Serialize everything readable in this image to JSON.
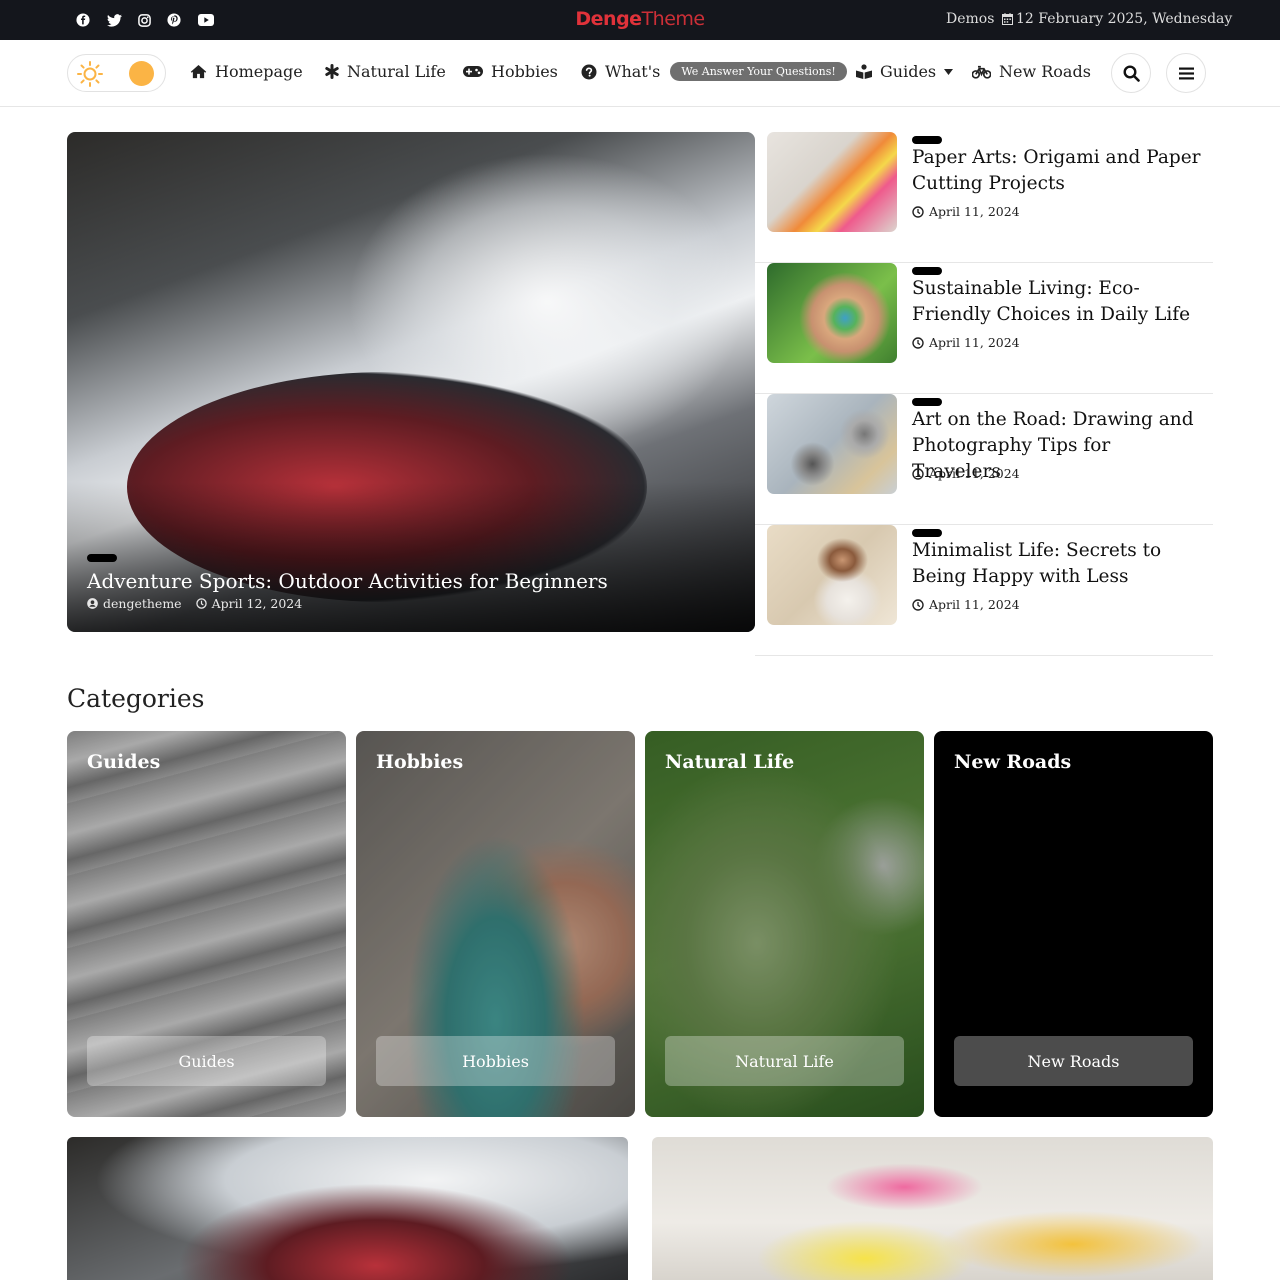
{
  "topbar": {
    "social_icons": [
      "facebook-icon",
      "twitter-icon",
      "instagram-icon",
      "pinterest-icon",
      "youtube-icon"
    ],
    "logo_part1": "Denge",
    "logo_part2": "Theme",
    "demos_label": "Demos",
    "date_text": "12 February 2025, Wednesday"
  },
  "nav": {
    "items": [
      {
        "label": "Homepage",
        "icon": "home-icon"
      },
      {
        "label": "Natural Life",
        "icon": "asterisk-icon"
      },
      {
        "label": "Hobbies",
        "icon": "gamepad-icon"
      },
      {
        "label": "What's",
        "icon": "question-icon"
      },
      {
        "label": "Guides",
        "icon": "book-reader-icon"
      },
      {
        "label": "New Roads",
        "icon": "bicycle-icon"
      }
    ],
    "pill_text": "We Answer Your Questions!"
  },
  "hero": {
    "title": "Adventure Sports: Outdoor Activities for Beginners",
    "author": "dengetheme",
    "date": "April 12, 2024"
  },
  "side_posts": [
    {
      "title": "Paper Arts: Origami and Paper Cutting Projects",
      "date": "April 11, 2024"
    },
    {
      "title": "Sustainable Living: Eco-Friendly Choices in Daily Life",
      "date": "April 11, 2024"
    },
    {
      "title": "Art on the Road: Drawing and Photography Tips for Travelers",
      "date": "April 11, 2024"
    },
    {
      "title": "Minimalist Life: Secrets to Being Happy with Less",
      "date": "April 11, 2024"
    }
  ],
  "categories": {
    "heading": "Categories",
    "cards": [
      {
        "name": "Guides",
        "button": "Guides"
      },
      {
        "name": "Hobbies",
        "button": "Hobbies"
      },
      {
        "name": "Natural Life",
        "button": "Natural Life"
      },
      {
        "name": "New Roads",
        "button": "New Roads"
      }
    ]
  },
  "colors": {
    "accent": "#e0323a",
    "topbar_bg": "#14161c",
    "toggle_sun": "#fbb445"
  }
}
